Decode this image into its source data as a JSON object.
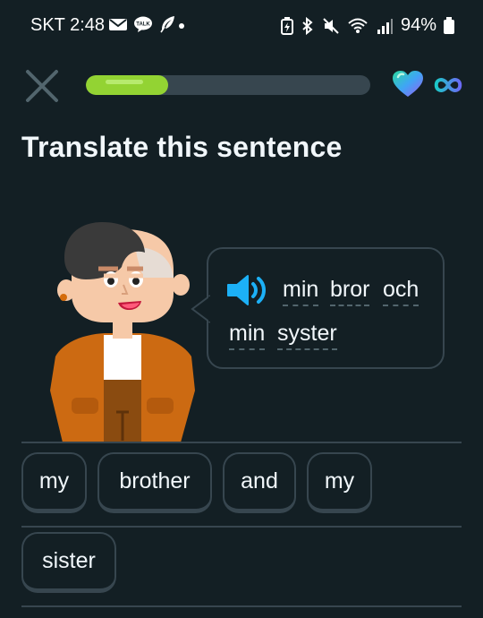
{
  "status_bar": {
    "carrier_time": "SKT 2:48",
    "battery": "94%",
    "icons": [
      "mail-icon",
      "talk-icon",
      "feather-icon",
      "battery-saver-icon",
      "bluetooth-icon",
      "mute-icon",
      "wifi-icon",
      "signal-icon",
      "battery-icon"
    ]
  },
  "header": {
    "progress": 0.29,
    "close_icon": "close-icon",
    "hearts_icon": "heart-icon",
    "hearts_value_icon": "infinity-icon"
  },
  "prompt": {
    "title": "Translate this sentence"
  },
  "speech": {
    "words": [
      "min",
      "bror",
      "och",
      "min",
      "syster"
    ]
  },
  "word_bank": {
    "chips": [
      "my",
      "brother",
      "and",
      "my",
      "sister"
    ]
  },
  "colors": {
    "background": "#131f24",
    "border": "#37464f",
    "progress_fill": "#93d333",
    "speaker": "#1cb0f6",
    "jacket": "#cc6a12"
  }
}
